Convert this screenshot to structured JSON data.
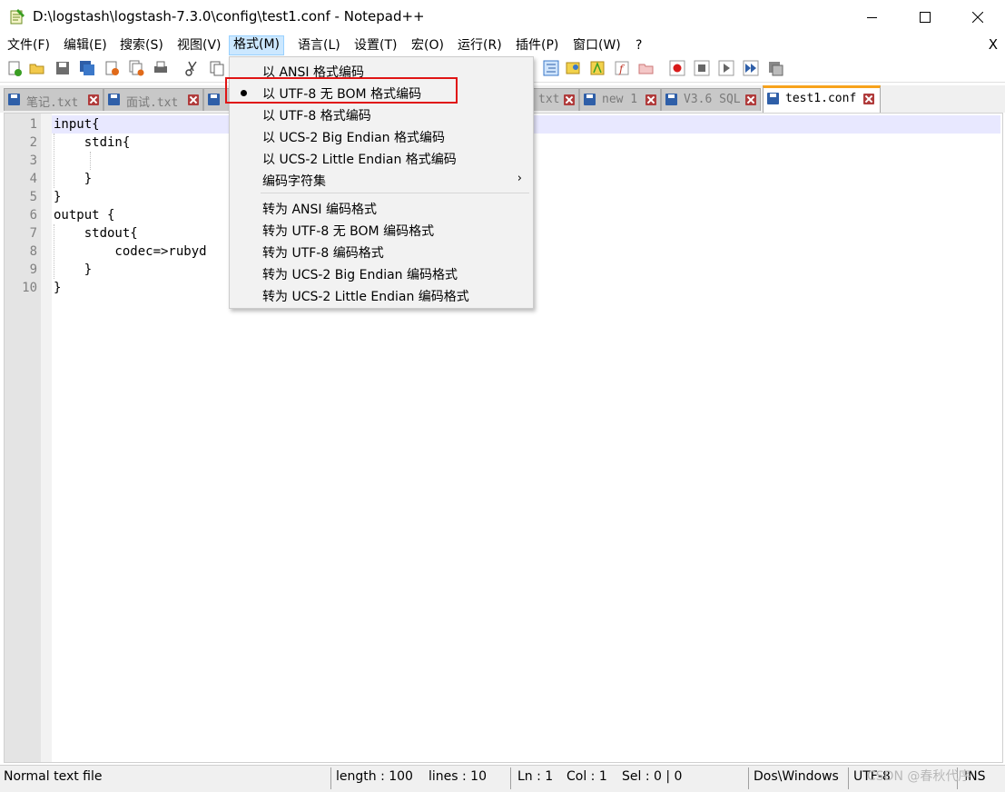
{
  "window": {
    "title": "D:\\logstash\\logstash-7.3.0\\config\\test1.conf - Notepad++"
  },
  "menubar": {
    "items": [
      "文件(F)",
      "编辑(E)",
      "搜索(S)",
      "视图(V)",
      "格式(M)",
      "语言(L)",
      "设置(T)",
      "宏(O)",
      "运行(R)",
      "插件(P)",
      "窗口(W)",
      "?"
    ],
    "active": "格式(M)",
    "close_label": "X"
  },
  "tabs": [
    {
      "label": "笔记.txt"
    },
    {
      "label": "面试.txt"
    },
    {
      "label": ""
    },
    {
      "label": "txt"
    },
    {
      "label": "new 1"
    },
    {
      "label": "V3.6 SQL"
    },
    {
      "label": "test1.conf",
      "active": true
    }
  ],
  "editor": {
    "line_numbers": [
      "1",
      "2",
      "3",
      "4",
      "5",
      "6",
      "7",
      "8",
      "9",
      "10"
    ],
    "lines": [
      "input{",
      "    stdin{",
      "",
      "    }",
      "}",
      "output {",
      "    stdout{",
      "        codec=>rubyd",
      "    }",
      "}"
    ],
    "current_line": 1
  },
  "format_menu": {
    "items": [
      {
        "label": "以 ANSI 格式编码"
      },
      {
        "label": "以 UTF-8 无 BOM 格式编码",
        "checked": true
      },
      {
        "label": "以 UTF-8 格式编码"
      },
      {
        "label": "以 UCS-2 Big Endian 格式编码"
      },
      {
        "label": "以 UCS-2 Little Endian 格式编码"
      },
      {
        "label": "编码字符集",
        "submenu": true
      },
      {
        "label": "转为 ANSI 编码格式"
      },
      {
        "label": "转为 UTF-8 无 BOM 编码格式"
      },
      {
        "label": "转为 UTF-8 编码格式"
      },
      {
        "label": "转为 UCS-2 Big Endian 编码格式"
      },
      {
        "label": "转为 UCS-2 Little Endian 编码格式"
      }
    ],
    "submenu_arrow": "›",
    "highlight_color": "#e01515"
  },
  "statusbar": {
    "file_type": "Normal text file",
    "length": "length : 100",
    "lines": "lines : 10",
    "ln": "Ln : 1",
    "col": "Col : 1",
    "sel": "Sel : 0 | 0",
    "eol": "Dos\\Windows",
    "encoding": "UTF-8",
    "mode": "INS"
  },
  "watermark": "CSDN @春秋代序",
  "colors": {
    "active_tab_accent": "#f7a21b",
    "menu_active_bg": "#cce8ff",
    "current_line_bg": "#e8e8ff"
  }
}
